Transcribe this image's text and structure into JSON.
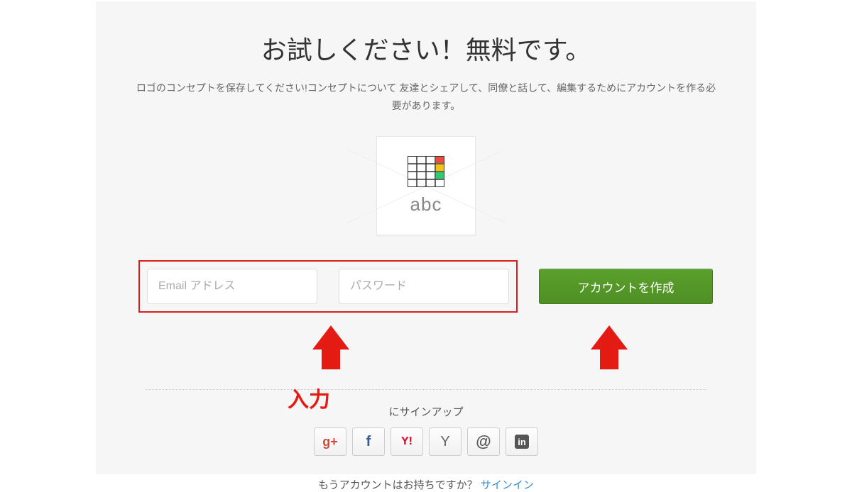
{
  "heading": "お試しください！無料です。",
  "subtext": "ロゴのコンセプトを保存してください!コンセプトについて 友達とシェアして、同僚と話して、編集するためにアカウントを作る必要があります。",
  "logo": {
    "text": "abc"
  },
  "form": {
    "email_placeholder": "Email アドレス",
    "password_placeholder": "パスワード",
    "submit_label": "アカウントを作成"
  },
  "annotation": {
    "input_label": "入力"
  },
  "signup": {
    "label": "にサインアップ",
    "providers": {
      "google": "g+",
      "facebook": "f",
      "yahoo_jp": "Y!",
      "yahoo": "Y",
      "email": "@",
      "linkedin": "in"
    }
  },
  "signin": {
    "prompt": "もうアカウントはお持ちですか？ ",
    "link_text": "サインイン"
  }
}
